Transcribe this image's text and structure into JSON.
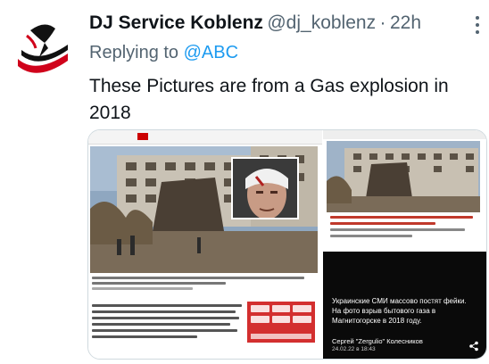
{
  "tweet": {
    "display_name": "DJ Service Koblenz",
    "handle": "@dj_koblenz",
    "separator": "·",
    "time": "22h",
    "reply_prefix": "Replying to ",
    "reply_to": "@ABC",
    "text": "These Pictures are from a Gas explosion in 2018"
  },
  "media": {
    "right_panel": {
      "text": "Украинские СМИ массово постят фейки. На фото взрыв бытового газа в Магнитогорске в 2018 году.",
      "author": "Сергей \"Zergulio\" Колесников",
      "date": "24.02.22 в 18:43"
    }
  },
  "colors": {
    "accent": "#1d9bf0",
    "secondary_text": "#536471",
    "primary_text": "#0f1419",
    "logo_red": "#d0021b"
  }
}
